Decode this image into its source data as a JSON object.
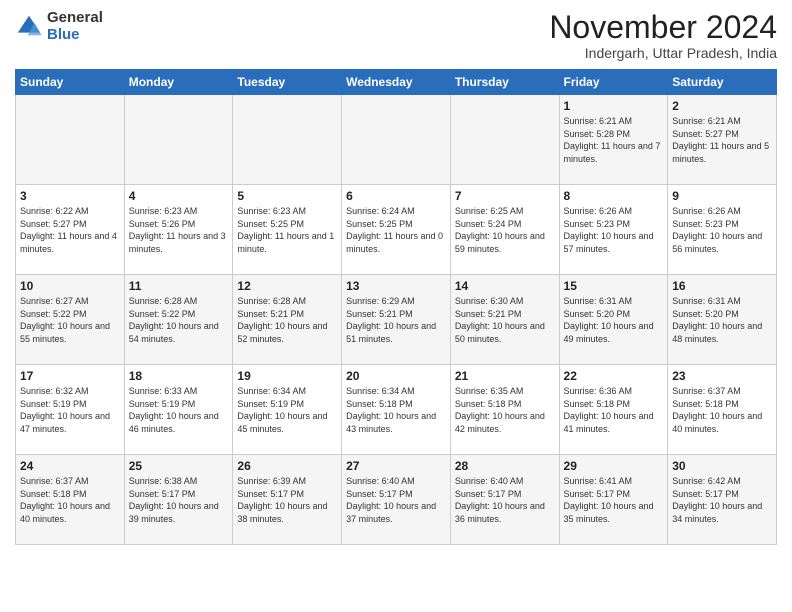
{
  "header": {
    "logo_general": "General",
    "logo_blue": "Blue",
    "month_title": "November 2024",
    "location": "Indergarh, Uttar Pradesh, India"
  },
  "weekdays": [
    "Sunday",
    "Monday",
    "Tuesday",
    "Wednesday",
    "Thursday",
    "Friday",
    "Saturday"
  ],
  "weeks": [
    [
      {
        "day": "",
        "info": ""
      },
      {
        "day": "",
        "info": ""
      },
      {
        "day": "",
        "info": ""
      },
      {
        "day": "",
        "info": ""
      },
      {
        "day": "",
        "info": ""
      },
      {
        "day": "1",
        "info": "Sunrise: 6:21 AM\nSunset: 5:28 PM\nDaylight: 11 hours and 7 minutes."
      },
      {
        "day": "2",
        "info": "Sunrise: 6:21 AM\nSunset: 5:27 PM\nDaylight: 11 hours and 5 minutes."
      }
    ],
    [
      {
        "day": "3",
        "info": "Sunrise: 6:22 AM\nSunset: 5:27 PM\nDaylight: 11 hours and 4 minutes."
      },
      {
        "day": "4",
        "info": "Sunrise: 6:23 AM\nSunset: 5:26 PM\nDaylight: 11 hours and 3 minutes."
      },
      {
        "day": "5",
        "info": "Sunrise: 6:23 AM\nSunset: 5:25 PM\nDaylight: 11 hours and 1 minute."
      },
      {
        "day": "6",
        "info": "Sunrise: 6:24 AM\nSunset: 5:25 PM\nDaylight: 11 hours and 0 minutes."
      },
      {
        "day": "7",
        "info": "Sunrise: 6:25 AM\nSunset: 5:24 PM\nDaylight: 10 hours and 59 minutes."
      },
      {
        "day": "8",
        "info": "Sunrise: 6:26 AM\nSunset: 5:23 PM\nDaylight: 10 hours and 57 minutes."
      },
      {
        "day": "9",
        "info": "Sunrise: 6:26 AM\nSunset: 5:23 PM\nDaylight: 10 hours and 56 minutes."
      }
    ],
    [
      {
        "day": "10",
        "info": "Sunrise: 6:27 AM\nSunset: 5:22 PM\nDaylight: 10 hours and 55 minutes."
      },
      {
        "day": "11",
        "info": "Sunrise: 6:28 AM\nSunset: 5:22 PM\nDaylight: 10 hours and 54 minutes."
      },
      {
        "day": "12",
        "info": "Sunrise: 6:28 AM\nSunset: 5:21 PM\nDaylight: 10 hours and 52 minutes."
      },
      {
        "day": "13",
        "info": "Sunrise: 6:29 AM\nSunset: 5:21 PM\nDaylight: 10 hours and 51 minutes."
      },
      {
        "day": "14",
        "info": "Sunrise: 6:30 AM\nSunset: 5:21 PM\nDaylight: 10 hours and 50 minutes."
      },
      {
        "day": "15",
        "info": "Sunrise: 6:31 AM\nSunset: 5:20 PM\nDaylight: 10 hours and 49 minutes."
      },
      {
        "day": "16",
        "info": "Sunrise: 6:31 AM\nSunset: 5:20 PM\nDaylight: 10 hours and 48 minutes."
      }
    ],
    [
      {
        "day": "17",
        "info": "Sunrise: 6:32 AM\nSunset: 5:19 PM\nDaylight: 10 hours and 47 minutes."
      },
      {
        "day": "18",
        "info": "Sunrise: 6:33 AM\nSunset: 5:19 PM\nDaylight: 10 hours and 46 minutes."
      },
      {
        "day": "19",
        "info": "Sunrise: 6:34 AM\nSunset: 5:19 PM\nDaylight: 10 hours and 45 minutes."
      },
      {
        "day": "20",
        "info": "Sunrise: 6:34 AM\nSunset: 5:18 PM\nDaylight: 10 hours and 43 minutes."
      },
      {
        "day": "21",
        "info": "Sunrise: 6:35 AM\nSunset: 5:18 PM\nDaylight: 10 hours and 42 minutes."
      },
      {
        "day": "22",
        "info": "Sunrise: 6:36 AM\nSunset: 5:18 PM\nDaylight: 10 hours and 41 minutes."
      },
      {
        "day": "23",
        "info": "Sunrise: 6:37 AM\nSunset: 5:18 PM\nDaylight: 10 hours and 40 minutes."
      }
    ],
    [
      {
        "day": "24",
        "info": "Sunrise: 6:37 AM\nSunset: 5:18 PM\nDaylight: 10 hours and 40 minutes."
      },
      {
        "day": "25",
        "info": "Sunrise: 6:38 AM\nSunset: 5:17 PM\nDaylight: 10 hours and 39 minutes."
      },
      {
        "day": "26",
        "info": "Sunrise: 6:39 AM\nSunset: 5:17 PM\nDaylight: 10 hours and 38 minutes."
      },
      {
        "day": "27",
        "info": "Sunrise: 6:40 AM\nSunset: 5:17 PM\nDaylight: 10 hours and 37 minutes."
      },
      {
        "day": "28",
        "info": "Sunrise: 6:40 AM\nSunset: 5:17 PM\nDaylight: 10 hours and 36 minutes."
      },
      {
        "day": "29",
        "info": "Sunrise: 6:41 AM\nSunset: 5:17 PM\nDaylight: 10 hours and 35 minutes."
      },
      {
        "day": "30",
        "info": "Sunrise: 6:42 AM\nSunset: 5:17 PM\nDaylight: 10 hours and 34 minutes."
      }
    ]
  ]
}
